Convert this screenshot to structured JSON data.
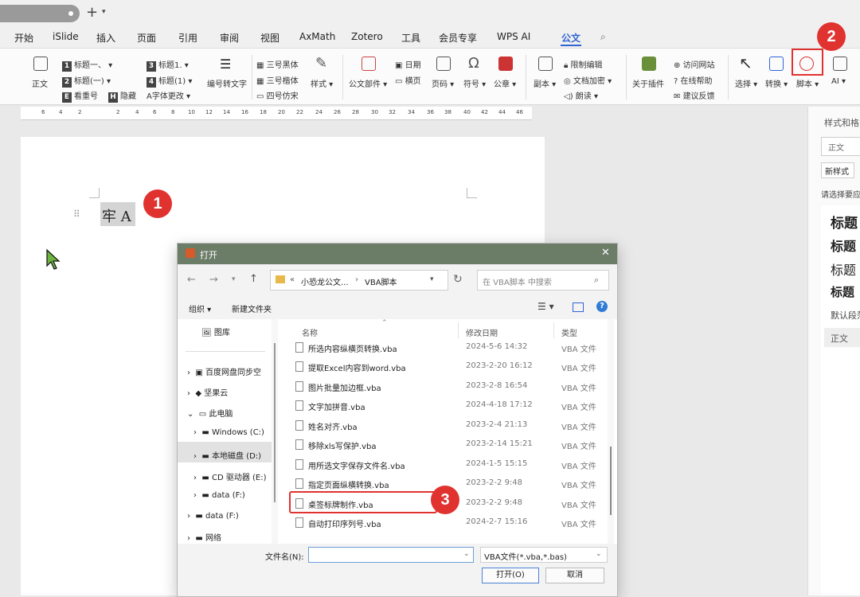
{
  "menu": {
    "items": [
      "开始",
      "iSlide",
      "插入",
      "页面",
      "引用",
      "审阅",
      "视图",
      "AxMath",
      "Zotero",
      "工具",
      "会员专享",
      "WPS AI",
      "公文"
    ]
  },
  "ribbon": {
    "style_normal": "正文",
    "heading1": "标题一、",
    "heading2": "标题(一)",
    "heading_view": "看重号",
    "hide": "隐藏",
    "title1": "标题1.",
    "title_paren1": "标题(1)",
    "font_change": "字体更改",
    "num_to_text": "编号转文字",
    "font_hei": "三号黑体",
    "font_kai": "三号楷体",
    "font_fangsong": "四号仿宋",
    "styles": "样式",
    "doc_parts": "公文部件",
    "date": "日期",
    "landscape": "横页",
    "page_num": "页码",
    "symbol": "符号",
    "seal": "公章",
    "copy": "副本",
    "restrict_edit": "限制编辑",
    "doc_encrypt": "文档加密",
    "read_aloud": "朗读",
    "about_plugin": "关于插件",
    "visit_site": "访问网站",
    "online_help": "在线帮助",
    "feedback": "建议反馈",
    "select": "选择",
    "convert": "转换",
    "script": "脚本",
    "ai": "AI"
  },
  "ruler_ticks": [
    "6",
    "4",
    "2",
    "2",
    "4",
    "6",
    "8",
    "10",
    "12",
    "14",
    "16",
    "18",
    "20",
    "22",
    "24",
    "26",
    "28",
    "30",
    "32",
    "34",
    "36",
    "38",
    "40",
    "42",
    "44",
    "46"
  ],
  "document": {
    "text": "牢 A"
  },
  "badges": [
    "1",
    "2",
    "3"
  ],
  "right_panel": {
    "title": "样式和格式",
    "current": "正文",
    "new_style": "新样式",
    "choose": "请选择要应",
    "styles": [
      "标题",
      "标题",
      "标题",
      "标题"
    ],
    "default_para": "默认段落",
    "bottom": "正文"
  },
  "dialog": {
    "title": "打开",
    "path": [
      "«",
      "小恐龙公文...",
      "›",
      "VBA脚本"
    ],
    "search_placeholder": "在 VBA脚本 中搜索",
    "organize": "组织 ▾",
    "new_folder": "新建文件夹",
    "nav": [
      "图库",
      "百度网盘同步空",
      "坚果云",
      "此电脑",
      "Windows (C:)",
      "本地磁盘 (D:)",
      "CD 驱动器 (E:)",
      "data (F:)",
      "data (F:)",
      "网络"
    ],
    "columns": {
      "name": "名称",
      "date": "修改日期",
      "type": "类型"
    },
    "files": [
      {
        "name": "所选内容纵横页转换.vba",
        "date": "2024-5-6 14:32",
        "type": "VBA 文件"
      },
      {
        "name": "提取Excel内容到word.vba",
        "date": "2023-2-20 16:12",
        "type": "VBA 文件"
      },
      {
        "name": "图片批量加边框.vba",
        "date": "2023-2-8 16:54",
        "type": "VBA 文件"
      },
      {
        "name": "文字加拼音.vba",
        "date": "2024-4-18 17:12",
        "type": "VBA 文件"
      },
      {
        "name": "姓名对齐.vba",
        "date": "2023-2-4 21:13",
        "type": "VBA 文件"
      },
      {
        "name": "移除xls写保护.vba",
        "date": "2023-2-14 15:21",
        "type": "VBA 文件"
      },
      {
        "name": "用所选文字保存文件名.vba",
        "date": "2024-1-5 15:15",
        "type": "VBA 文件"
      },
      {
        "name": "指定页面纵横转换.vba",
        "date": "2023-2-2 9:48",
        "type": "VBA 文件"
      },
      {
        "name": "桌签标牌制作.vba",
        "date": "2023-2-2 9:48",
        "type": "VBA 文件"
      },
      {
        "name": "自动打印序列号.vba",
        "date": "2024-2-7 15:16",
        "type": "VBA 文件"
      }
    ],
    "filename_label": "文件名(N):",
    "filename_value": "",
    "filetype": "VBA文件(*.vba,*.bas)",
    "open_button": "打开(O)",
    "cancel_button": "取消"
  },
  "colors": {
    "accent": "#2f64d6",
    "badge": "#e0322f",
    "titlebar": "#6b7c67"
  }
}
